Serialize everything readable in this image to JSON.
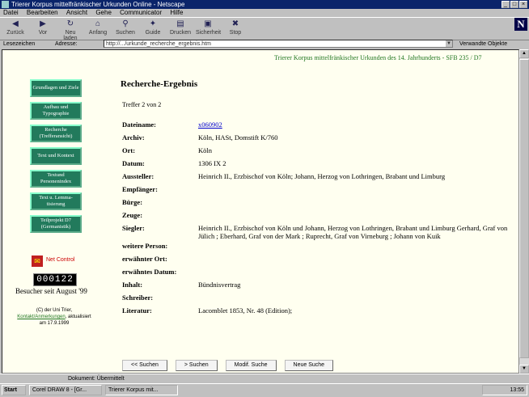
{
  "window": {
    "title": "Trierer Korpus mittelfränkischer Urkunden Online - Netscape"
  },
  "menu": [
    "Datei",
    "Bearbeiten",
    "Ansicht",
    "Gehe",
    "Communicator",
    "Hilfe"
  ],
  "toolbar": [
    {
      "label": "Zurück",
      "icon": "back-arrow-icon"
    },
    {
      "label": "Vor",
      "icon": "forward-arrow-icon"
    },
    {
      "label": "Neu laden",
      "icon": "reload-icon"
    },
    {
      "label": "Anfang",
      "icon": "home-icon"
    },
    {
      "label": "Suchen",
      "icon": "search-icon"
    },
    {
      "label": "Guide",
      "icon": "guide-icon"
    },
    {
      "label": "Drucken",
      "icon": "print-icon"
    },
    {
      "label": "Sicherheit",
      "icon": "lock-icon"
    },
    {
      "label": "Stop",
      "icon": "stop-icon"
    }
  ],
  "locationbar": {
    "bookmarks": "Lesezeichen",
    "address_label": "Adresse:",
    "url": "http://.../urkunde_recherche_ergebnis.htm",
    "related": "Verwandte Objekte"
  },
  "page": {
    "header": "Trierer Korpus mittelfränkischer Urkunden des 14. Jahrhunderts - SFB 235 / D7",
    "sidebar": [
      "Grundlagen und Ziele",
      "Aufbau und Typographie",
      "Recherche (Trefferansicht)",
      "Text und Kontext",
      "Textund Personenindex",
      "Text u. Lemma- tisierung",
      "Teilprojekt D7 (Germanistik)"
    ],
    "logo_text": "Net Control",
    "counter": "000122",
    "besucher": "Besucher seit August '99",
    "footer_prefix": "(C) der Uni Trier, ",
    "footer_link": "Kontakt/Anmerkungen",
    "footer_suffix": ", aktualisiert am 17.9.1999",
    "heading": "Recherche-Ergebnis",
    "treffer": "Treffer 2 von 2",
    "result": [
      {
        "k": "Dateiname:",
        "v": "x060902"
      },
      {
        "k": "Archiv:",
        "v": "Köln, HASt, Domstift K/760"
      },
      {
        "k": "Ort:",
        "v": "Köln"
      },
      {
        "k": "Datum:",
        "v": "1306 IX 2"
      },
      {
        "k": "Aussteller:",
        "v": "Heinrich II., Erzbischof von Köln; Johann, Herzog von Lothringen, Brabant und Limburg"
      },
      {
        "k": "Empfänger:",
        "v": ""
      },
      {
        "k": "Bürge:",
        "v": ""
      },
      {
        "k": "Zeuge:",
        "v": ""
      },
      {
        "k": "Siegler:",
        "v": "Heinrich II., Erzbischof von Köln und Johann, Herzog von Lothringen, Brabant und Limburg Gerhard, Graf von Jülich ; Eberhard, Graf von der Mark ; Ruprecht, Graf von Virneburg ; Johann von Kuik"
      },
      {
        "k": "weitere Person:",
        "v": ""
      },
      {
        "k": "erwähnter Ort:",
        "v": ""
      },
      {
        "k": "erwähntes Datum:",
        "v": ""
      },
      {
        "k": "Inhalt:",
        "v": "Bündnisvertrag"
      },
      {
        "k": "Schreiber:",
        "v": ""
      },
      {
        "k": "Literatur:",
        "v": "Lacomblet 1853, Nr. 48 (Edition);"
      }
    ],
    "buttons": [
      "<< Suchen",
      "> Suchen",
      "Modif. Suche",
      "Neue Suche"
    ]
  },
  "statusbar": "Dokument: Übermittelt",
  "taskbar": {
    "start": "Start",
    "tasks": [
      "Corel DRAW 8 - [Gr...",
      "Trierer Korpus mit..."
    ],
    "clock": "13:55"
  }
}
